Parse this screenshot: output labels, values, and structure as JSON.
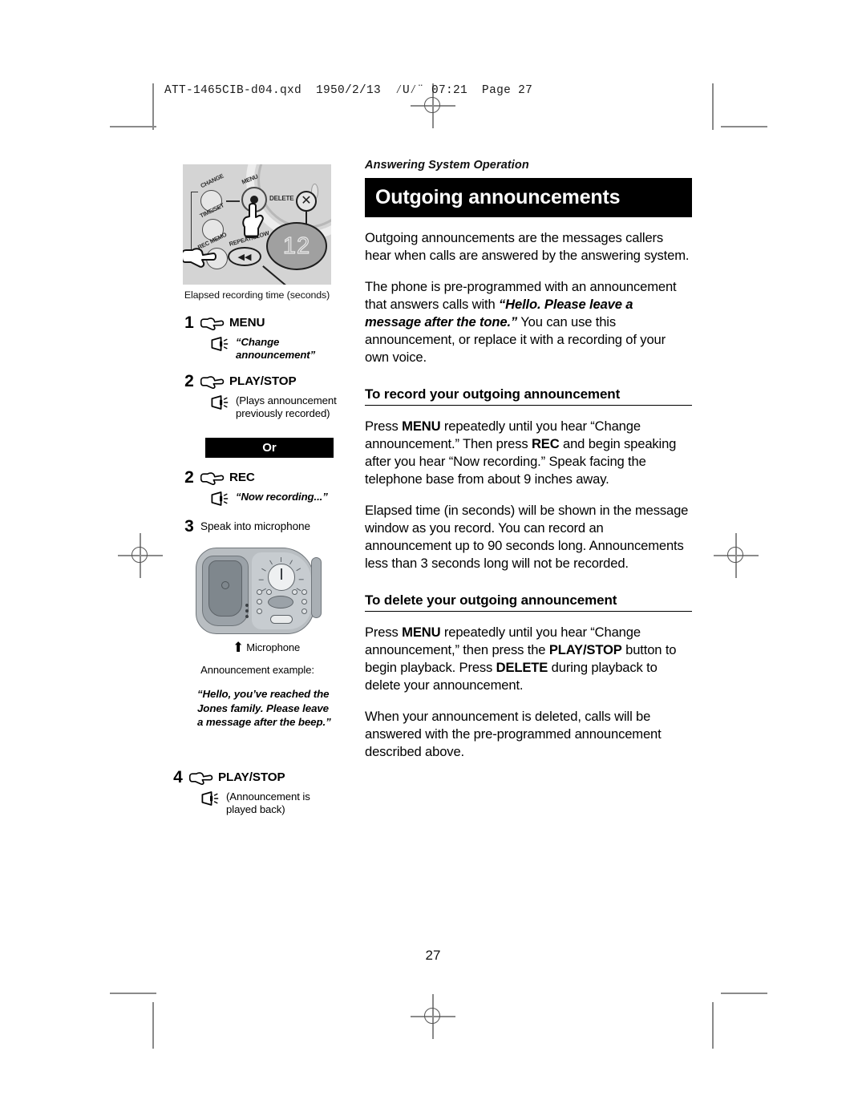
{
  "print_marks": {
    "slug_line": "ATT-1465CIB-d04.qxd  1950/2/13  ⁄U⁄¨ 07:21  Page 27"
  },
  "page": {
    "running_head": "Answering System Operation",
    "folio": "27"
  },
  "chapter": {
    "banner_title": "Outgoing announcements"
  },
  "right_column": {
    "intro_paragraph": "Outgoing announcements are the messages callers hear when calls are answered by the answering system.",
    "preprogrammed": {
      "lead": "The phone is pre-programmed with an announcement that answers calls with ",
      "quote": "“Hello. Please leave a message after the tone.”",
      "tail": " You can use this announcement, or replace it with a recording of your own voice."
    },
    "record_section": {
      "heading": "To record your outgoing announcement",
      "paragraph_1": {
        "p1": "Press ",
        "b1": "MENU",
        "p2": " repeatedly until you hear “Change announcement.” Then press ",
        "b2": "REC",
        "p3": " and begin speaking after you hear “Now recording.” Speak facing the telephone base from about 9 inches away."
      },
      "paragraph_2": "Elapsed time (in seconds) will be shown in the message window as you record. You can record an announcement up to 90 seconds long. Announcements less than 3 seconds long will not be recorded."
    },
    "delete_section": {
      "heading": "To delete your outgoing announcement",
      "paragraph_1": {
        "p1": "Press ",
        "b1": "MENU",
        "p2": " repeatedly until you hear “Change announcement,” then press the ",
        "b2": "PLAY/STOP",
        "p3": " button to begin playback. Press ",
        "b3": "DELETE",
        "p4": " during playback to delete your announcement."
      },
      "paragraph_2": "When your announcement is deleted, calls will be answered with the pre-programmed announcement described above."
    }
  },
  "left_column": {
    "control_panel_art": {
      "buttons": [
        {
          "label": "CHANGE"
        },
        {
          "label": "MENU"
        },
        {
          "label": "TIME/SET"
        },
        {
          "label": "REC MEMO"
        },
        {
          "label": "REPEAT/SLOW"
        },
        {
          "label": "DELETE"
        }
      ],
      "display_value": "12",
      "caption": "Elapsed recording time (seconds)"
    },
    "steps": [
      {
        "number": "1",
        "icon": "pointing-hand-icon",
        "button_label": "MENU",
        "feedback_icon": "speaker-icon",
        "feedback_text": "“Change announcement”",
        "feedback_style": "voice"
      },
      {
        "number": "2",
        "icon": "pointing-hand-icon",
        "button_label": "PLAY/STOP",
        "feedback_icon": "speaker-icon",
        "feedback_text": "(Plays announcement previously recorded)",
        "feedback_style": "plain"
      }
    ],
    "or_divider": "Or",
    "steps_alt": [
      {
        "number": "2",
        "icon": "pointing-hand-icon",
        "button_label": "REC",
        "feedback_icon": "speaker-icon",
        "feedback_text": "“Now recording...”",
        "feedback_style": "voice"
      },
      {
        "number": "3",
        "plain_text": "Speak into microphone"
      }
    ],
    "phone_art": {
      "microphone_label": "Microphone",
      "arrow_icon": "up-arrow-icon"
    },
    "example_label": "Announcement example:",
    "example_quote": "“Hello, you’ve reached the Jones family. Please leave a message after the beep.”",
    "final_step": {
      "number": "4",
      "icon": "pointing-hand-icon",
      "button_label": "PLAY/STOP",
      "feedback_icon": "speaker-icon",
      "feedback_text": "(Announcement is played back)",
      "feedback_style": "plain"
    }
  },
  "colors": {
    "banner_background": "#000000",
    "banner_text": "#ffffff",
    "page_background": "#ffffff",
    "body_text": "#000000",
    "crop_mark": "#8a8a8a",
    "panel_background": "#d4d4d4",
    "display_background": "#a0a0a0"
  }
}
